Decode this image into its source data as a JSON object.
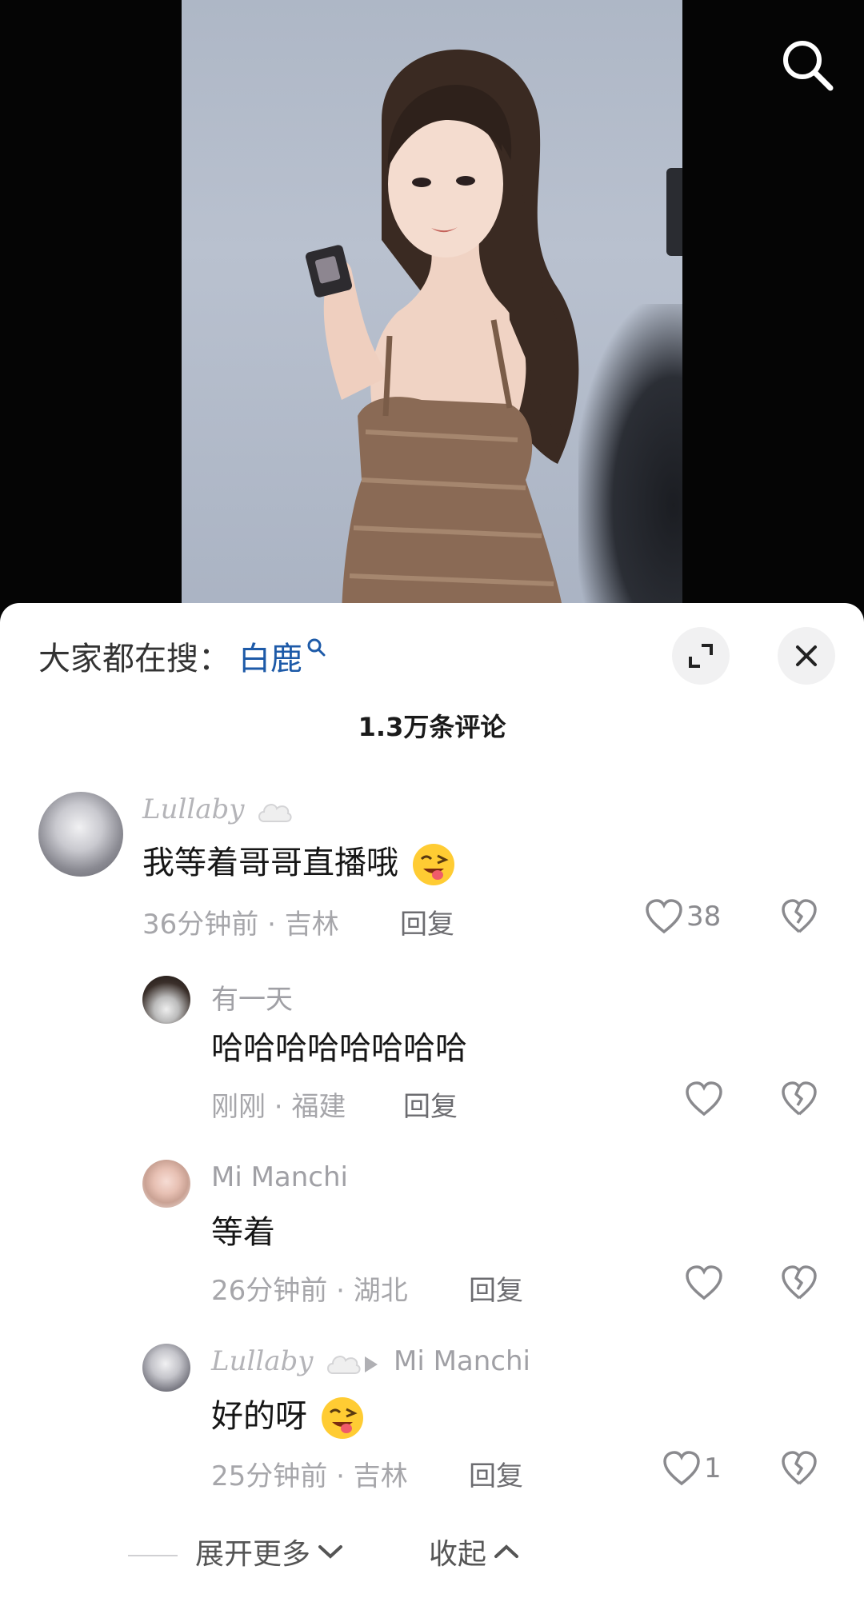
{
  "sheet": {
    "trend_prefix": "大家都在搜：",
    "trend_keyword": "白鹿",
    "comment_count": "1.3万条评论"
  },
  "comments": [
    {
      "user": "Lullaby",
      "text": "我等着哥哥直播哦",
      "time": "36分钟前",
      "location": "吉林",
      "reply": "回复",
      "likes": "38"
    },
    {
      "user": "有一天",
      "text": "哈哈哈哈哈哈哈哈",
      "time": "刚刚",
      "location": "福建",
      "reply": "回复",
      "likes": ""
    },
    {
      "user": "Mi Manchi",
      "text": "等着",
      "time": "26分钟前",
      "location": "湖北",
      "reply": "回复",
      "likes": ""
    },
    {
      "user": "Lullaby",
      "reply_to": "Mi Manchi",
      "text": "好的呀",
      "time": "25分钟前",
      "location": "吉林",
      "reply": "回复",
      "likes": "1"
    }
  ],
  "footer": {
    "expand_more": "展开更多",
    "collapse": "收起"
  },
  "colors": {
    "keyword": "#1d5aa8",
    "sheet_bg": "#ffffff"
  },
  "icons": [
    "search-icon",
    "search-small-icon",
    "expand-icon",
    "close-icon",
    "heart-icon",
    "broken-heart-icon",
    "chevron-down-icon",
    "chevron-up-icon",
    "cloud-icon",
    "wink-emoji"
  ]
}
